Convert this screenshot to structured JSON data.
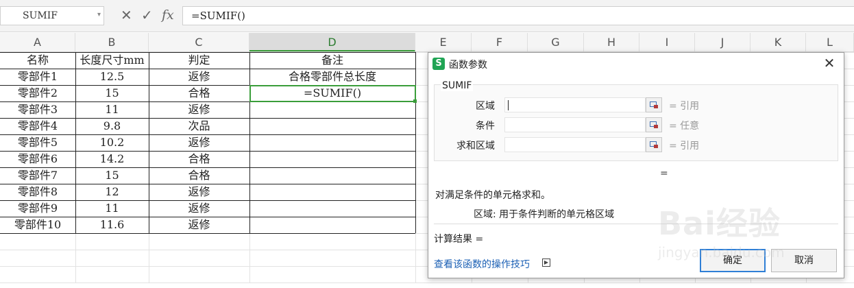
{
  "formula_bar": {
    "name_box": "SUMIF",
    "cancel_icon": "close-icon",
    "confirm_icon": "check-icon",
    "fx_label": "fx",
    "formula": "=SUMIF()"
  },
  "columns": [
    "A",
    "B",
    "C",
    "D",
    "E",
    "F",
    "G",
    "H",
    "I",
    "J",
    "K",
    "L"
  ],
  "active_column": "D",
  "table": {
    "headers": [
      "名称",
      "长度尺寸mm",
      "判定",
      "备注"
    ],
    "rows": [
      [
        "零部件1",
        "12.5",
        "返修",
        "合格零部件总长度"
      ],
      [
        "零部件2",
        "15",
        "合格",
        "=SUMIF()"
      ],
      [
        "零部件3",
        "11",
        "返修",
        ""
      ],
      [
        "零部件4",
        "9.8",
        "次品",
        ""
      ],
      [
        "零部件5",
        "10.2",
        "返修",
        ""
      ],
      [
        "零部件6",
        "14.2",
        "合格",
        ""
      ],
      [
        "零部件7",
        "15",
        "合格",
        ""
      ],
      [
        "零部件8",
        "12",
        "返修",
        ""
      ],
      [
        "零部件9",
        "11",
        "返修",
        ""
      ],
      [
        "零部件10",
        "11.6",
        "返修",
        ""
      ]
    ]
  },
  "dialog": {
    "title": "函数参数",
    "function_name": "SUMIF",
    "args": [
      {
        "label": "区域",
        "value": "",
        "result": "= 引用"
      },
      {
        "label": "条件",
        "value": "",
        "result": "= 任意"
      },
      {
        "label": "求和区域",
        "value": "",
        "result": "= 引用"
      }
    ],
    "overall_result": "=",
    "description": "对满足条件的单元格求和。",
    "param_description": "区域:  用于条件判断的单元格区域",
    "calc_result": "计算结果 =",
    "help_link": "查看该函数的操作技巧",
    "ok_label": "确定",
    "cancel_label": "取消"
  },
  "watermark": {
    "text": "Bai经验",
    "sub": "jingyan.baidu.com"
  }
}
